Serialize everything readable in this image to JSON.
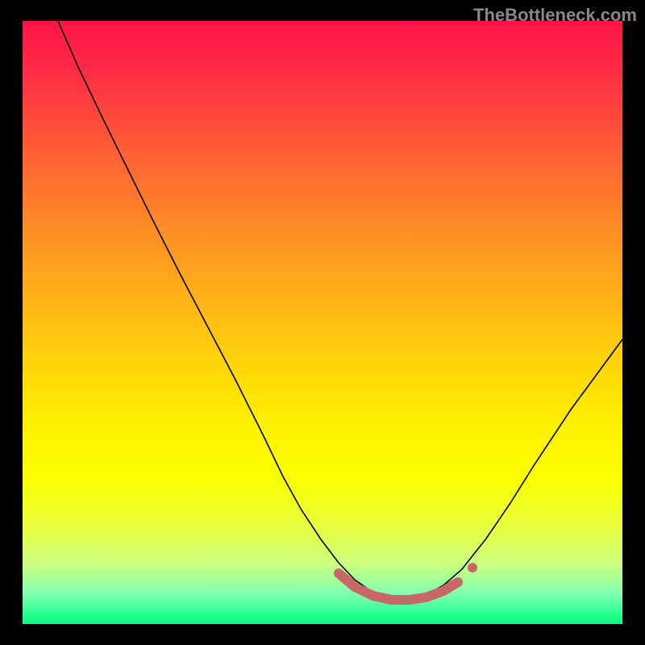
{
  "watermark": "TheBottleneck.com",
  "chart_data": {
    "type": "line",
    "title": "",
    "xlabel": "",
    "ylabel": "",
    "xlim": [
      0,
      100
    ],
    "ylim": [
      0,
      100
    ],
    "axes_visible": false,
    "grid": false,
    "background": "gradient-red-to-green",
    "series": [
      {
        "name": "bottleneck-curve",
        "x": [
          10,
          15,
          20,
          25,
          30,
          35,
          40,
          45,
          50,
          52,
          55,
          58,
          60,
          62,
          65,
          68,
          70,
          72,
          75,
          78,
          82,
          86,
          90,
          95,
          100
        ],
        "values": [
          100,
          90,
          80,
          70,
          60,
          50,
          40,
          30,
          20,
          15,
          10,
          6,
          4,
          3,
          3,
          3,
          3.5,
          5,
          8,
          12,
          18,
          25,
          32,
          40,
          48
        ]
      }
    ],
    "optimal_zone": {
      "x_start": 52,
      "x_end": 75,
      "y_approx": 3.5
    }
  },
  "colors": {
    "curve_stroke": "#000000",
    "marker_stroke": "#c96666",
    "background_black": "#000000"
  }
}
